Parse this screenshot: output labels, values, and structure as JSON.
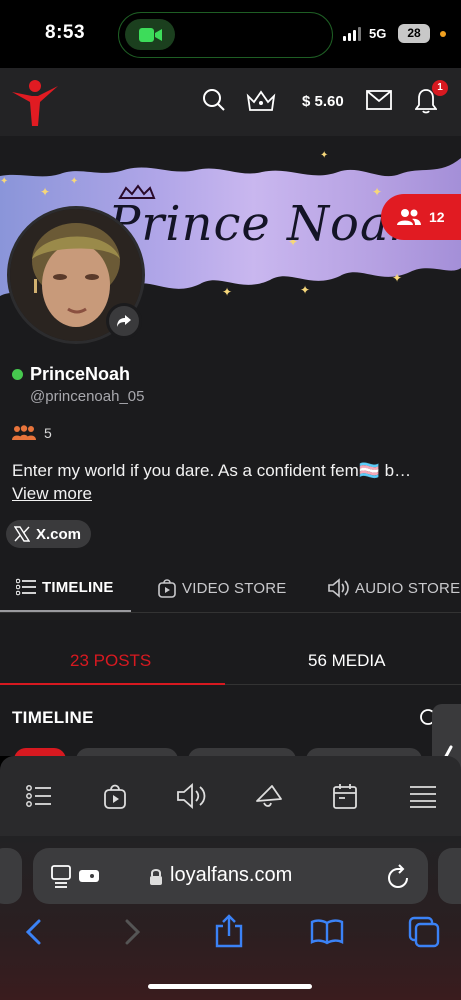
{
  "status_bar": {
    "time": "8:53",
    "network": "5G",
    "battery": "28"
  },
  "header": {
    "balance": "$ 5.60",
    "notification_count": "1"
  },
  "banner": {
    "title": "Prince Noah",
    "followers": "12"
  },
  "profile": {
    "display_name": "PrinceNoah",
    "handle": "@princenoah_05",
    "fans_count": "5",
    "bio": "Enter my world if you dare. As a confident fem🏳️‍⚧️ b…",
    "view_more": "View more",
    "social_link": "X.com"
  },
  "tabs": [
    {
      "label": "TIMELINE",
      "icon": "list-icon"
    },
    {
      "label": "VIDEO STORE",
      "icon": "video-store-icon"
    },
    {
      "label": "AUDIO STORE",
      "icon": "speaker-icon"
    }
  ],
  "sub_tabs": {
    "posts": "23 POSTS",
    "media": "56 MEDIA"
  },
  "section_title": "TIMELINE",
  "bottom_nav": [
    "list-icon",
    "video-store-icon",
    "speaker-icon",
    "megaphone-icon",
    "calendar-icon",
    "menu-icon"
  ],
  "safari": {
    "url": "loyalfans.com"
  },
  "colors": {
    "accent": "#d71920",
    "online": "#46c84e",
    "background": "#1b1b1d",
    "header": "#232325"
  }
}
